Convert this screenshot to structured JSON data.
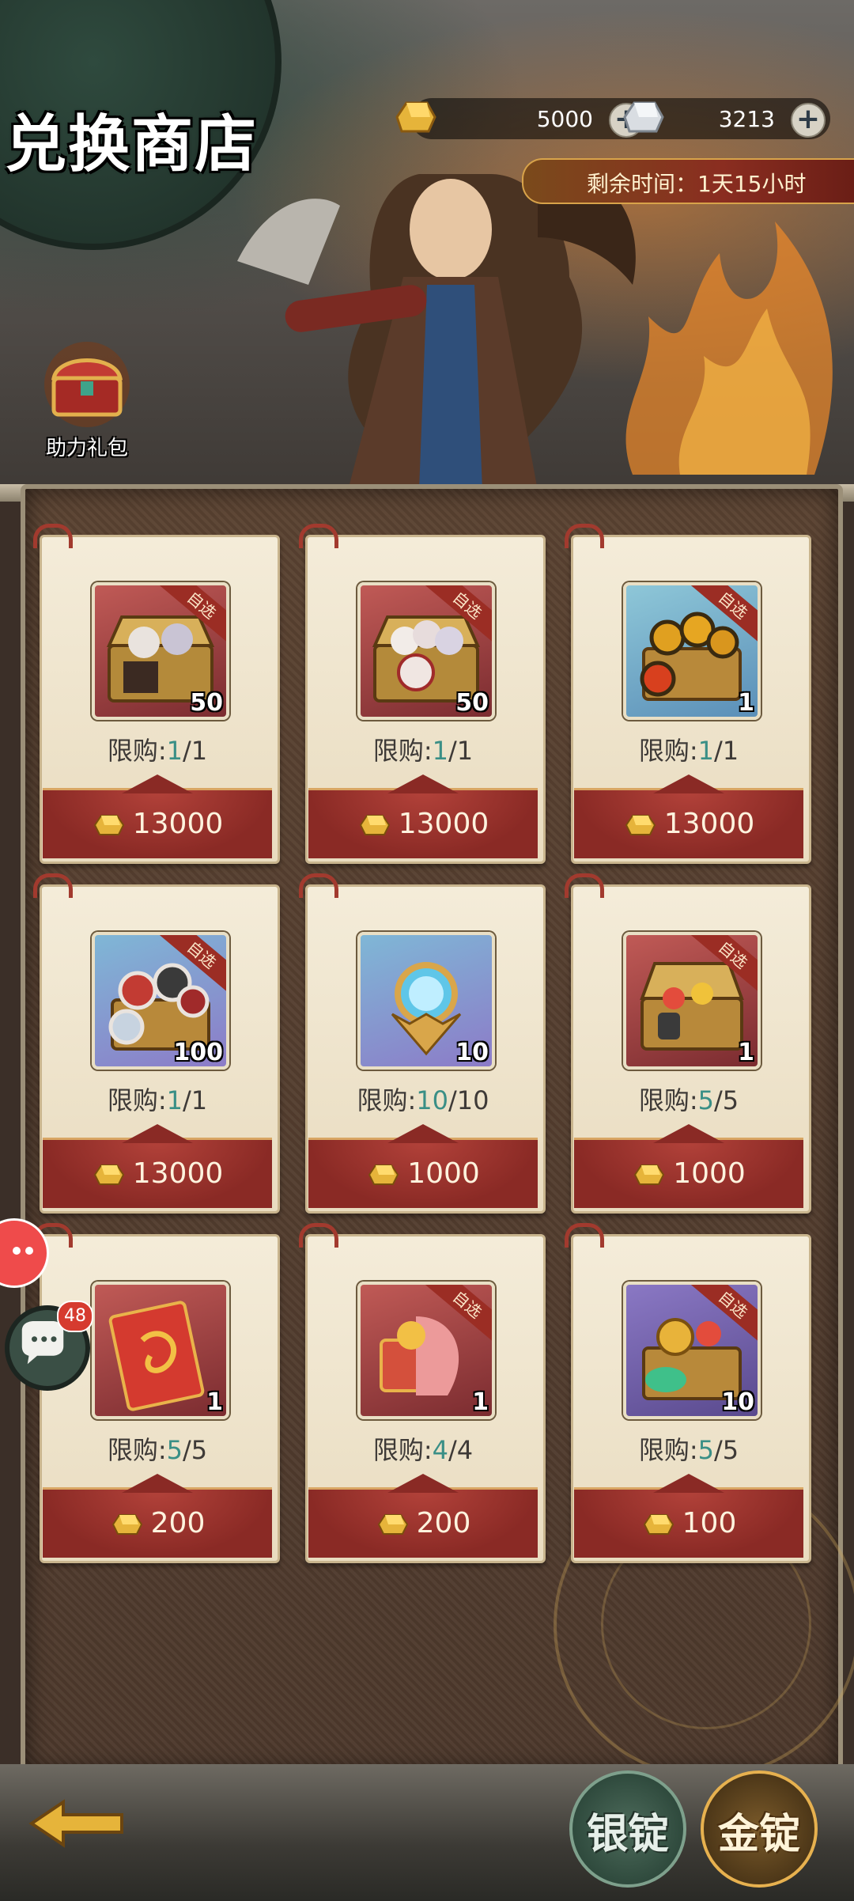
{
  "header": {
    "title": "兑换商店",
    "gold_amount": "5000",
    "silver_amount": "3213",
    "timer_label": "剩余时间：1天15小时",
    "gift_label": "助力礼包"
  },
  "labels": {
    "limit_prefix": "限购:",
    "pick_tag": "自选"
  },
  "items": [
    {
      "qty": "50",
      "limit_cur": "1",
      "limit_max": "/1",
      "price": "13000",
      "tag": "自选"
    },
    {
      "qty": "50",
      "limit_cur": "1",
      "limit_max": "/1",
      "price": "13000",
      "tag": "自选"
    },
    {
      "qty": "1",
      "limit_cur": "1",
      "limit_max": "/1",
      "price": "13000",
      "tag": "自选"
    },
    {
      "qty": "100",
      "limit_cur": "1",
      "limit_max": "/1",
      "price": "13000",
      "tag": "自选"
    },
    {
      "qty": "10",
      "limit_cur": "10",
      "limit_max": "/10",
      "price": "1000",
      "tag": ""
    },
    {
      "qty": "1",
      "limit_cur": "5",
      "limit_max": "/5",
      "price": "1000",
      "tag": "自选"
    },
    {
      "qty": "1",
      "limit_cur": "5",
      "limit_max": "/5",
      "price": "200",
      "tag": ""
    },
    {
      "qty": "1",
      "limit_cur": "4",
      "limit_max": "/4",
      "price": "200",
      "tag": "自选"
    },
    {
      "qty": "10",
      "limit_cur": "5",
      "limit_max": "/5",
      "price": "100",
      "tag": "自选"
    }
  ],
  "chat_badge": "48",
  "bottom": {
    "tab_silver": "银锭",
    "tab_gold": "金锭"
  },
  "colors": {
    "accent_red": "#8a2a25",
    "limit_teal": "#3a8f86",
    "gold": "#e6b43a"
  }
}
